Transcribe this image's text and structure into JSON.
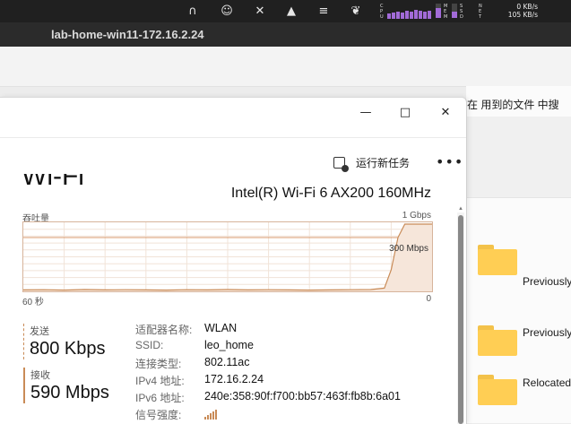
{
  "menubar": {
    "icons": [
      {
        "name": "headphones-icon",
        "glyph": "∩"
      },
      {
        "name": "face-icon",
        "glyph": "☺"
      },
      {
        "name": "tools-icon",
        "glyph": "✕"
      },
      {
        "name": "mountain-icon",
        "glyph": "▲"
      },
      {
        "name": "menu-icon",
        "glyph": "≡"
      },
      {
        "name": "bird-icon",
        "glyph": "❦"
      }
    ],
    "cpu_label": "CPU",
    "mem_label": "MEM",
    "ssd_label": "SSD",
    "mem_level": 0.7,
    "ssd_level": 0.45,
    "net_label": "NET",
    "net_up": "0 KB/s",
    "net_down": "105 KB/s",
    "accent": "#a26bd8"
  },
  "rdp": {
    "title": "lab-home-win11-172.16.2.24"
  },
  "explorer": {
    "search_hint": "在 用到的文件 中搜",
    "folders": [
      "Previously",
      "Previously",
      "Relocated"
    ],
    "folder_color": "#ffce54"
  },
  "task_manager": {
    "window_controls": {
      "minimize": "—",
      "maximize": "□",
      "close": "✕"
    },
    "toolbar": {
      "run_new_task": "运行新任务",
      "more": "•••"
    },
    "wifi": {
      "title": "Wi-Fi",
      "adapter": "Intel(R) Wi-Fi 6 AX200 160MHz",
      "throughput_label": "吞吐量",
      "max_label": "1 Gbps",
      "mid_label": "300 Mbps",
      "time_left": "60 秒",
      "time_right": "0",
      "send_label": "发送",
      "send_value": "800 Kbps",
      "recv_label": "接收",
      "recv_value": "590 Mbps"
    },
    "properties": [
      {
        "key": "适配器名称:",
        "value": "WLAN"
      },
      {
        "key": "SSID:",
        "value": "leo_home"
      },
      {
        "key": "连接类型:",
        "value": "802.11ac"
      },
      {
        "key": "IPv4 地址:",
        "value": "172.16.2.24"
      },
      {
        "key": "IPv6 地址:",
        "value": "240e:358:90f:f700:bb57:463f:fb8b:6a01"
      },
      {
        "key": "信号强度:",
        "value": ""
      }
    ],
    "graph_color": "#c98b57"
  },
  "chart_data": {
    "type": "line",
    "x": [
      60,
      57,
      54,
      51,
      48,
      45,
      42,
      39,
      36,
      33,
      30,
      27,
      24,
      21,
      18,
      15,
      12,
      9,
      7,
      6,
      5,
      4,
      3,
      2,
      1,
      0
    ],
    "series": [
      {
        "values": [
          8,
          9,
          7,
          10,
          8,
          9,
          8,
          7,
          9,
          8,
          10,
          8,
          9,
          8,
          7,
          8,
          9,
          10,
          18,
          120,
          300,
          390,
          420,
          430,
          410,
          420
        ]
      }
    ],
    "ylabel": "吞吐量",
    "ylim": [
      0,
      1000
    ],
    "grid": true
  }
}
